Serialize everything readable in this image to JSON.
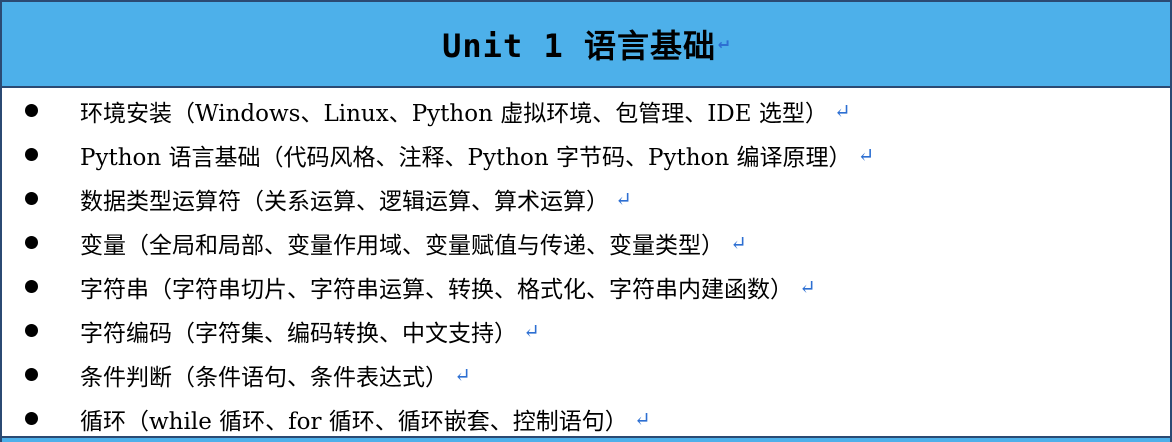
{
  "header": {
    "title": "Unit 1 语言基础",
    "return_mark": "↵"
  },
  "topics": [
    {
      "text": "环境安装（Windows、Linux、Python 虚拟环境、包管理、IDE 选型）",
      "mark": "↵"
    },
    {
      "text": "Python 语言基础（代码风格、注释、Python 字节码、Python 编译原理）",
      "mark": "↵"
    },
    {
      "text": "数据类型运算符（关系运算、逻辑运算、算术运算）",
      "mark": "↵"
    },
    {
      "text": "变量（全局和局部、变量作用域、变量赋值与传递、变量类型）",
      "mark": "↵"
    },
    {
      "text": "字符串（字符串切片、字符串运算、转换、格式化、字符串内建函数）",
      "mark": "↵"
    },
    {
      "text": "字符编码（字符集、编码转换、中文支持）",
      "mark": "↵"
    },
    {
      "text": "条件判断（条件语句、条件表达式）",
      "mark": "↵"
    },
    {
      "text": "循环（while 循环、for 循环、循环嵌套、控制语句）",
      "mark": "↵"
    }
  ],
  "colors": {
    "header_bg": "#4db0ea",
    "border": "#2b4a73",
    "return_mark": "#2d6fd2"
  }
}
